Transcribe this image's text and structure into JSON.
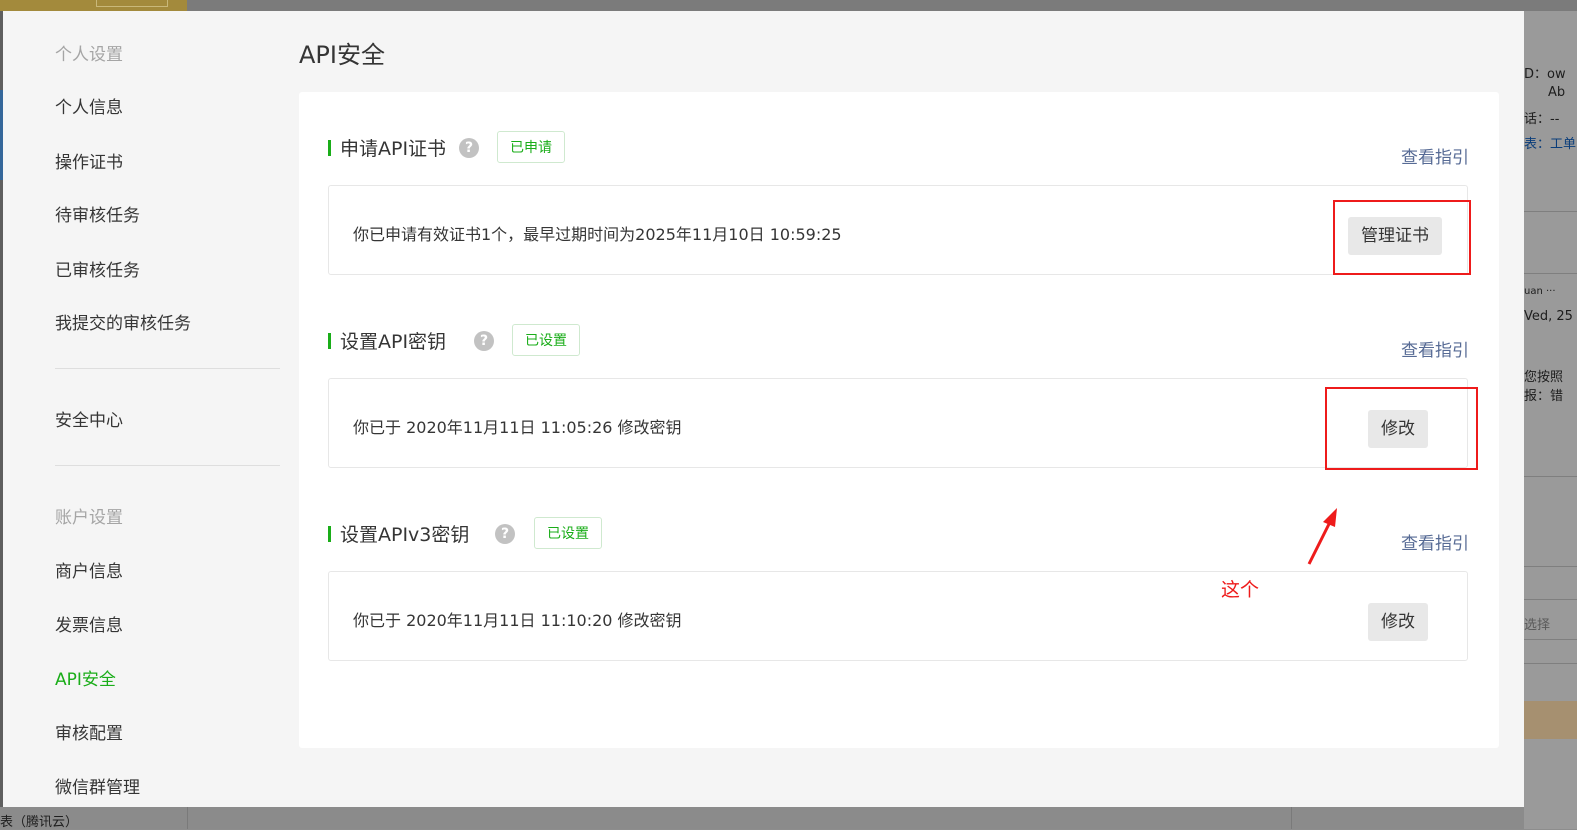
{
  "background": {
    "right_panel_texts": [
      "D：ow",
      "Ab",
      "话：--",
      "表：工单",
      "uan ···",
      "Ved, 25",
      "您按照",
      "报：错",
      "选择"
    ],
    "bottom_text": "表（腾讯云）"
  },
  "sidebar": {
    "groups": [
      {
        "title": "个人设置",
        "items": [
          "个人信息",
          "操作证书",
          "待审核任务",
          "已审核任务",
          "我提交的审核任务"
        ]
      },
      {
        "title": "",
        "items": [
          "安全中心"
        ]
      },
      {
        "title": "账户设置",
        "items": [
          "商户信息",
          "发票信息",
          "API安全",
          "审核配置",
          "微信群管理"
        ]
      }
    ],
    "active_item": "API安全"
  },
  "page": {
    "title": "API安全"
  },
  "sections": [
    {
      "title": "申请API证书",
      "badge": "已申请",
      "guide_link": "查看指引",
      "info": "你已申请有效证书1个，最早过期时间为2025年11月10日 10:59:25",
      "button": "管理证书"
    },
    {
      "title": "设置API密钥",
      "badge": "已设置",
      "guide_link": "查看指引",
      "info": "你已于 2020年11月11日 11:05:26 修改密钥",
      "button": "修改"
    },
    {
      "title": "设置APIv3密钥",
      "badge": "已设置",
      "guide_link": "查看指引",
      "info": "你已于 2020年11月11日 11:10:20 修改密钥",
      "button": "修改"
    }
  ],
  "annotation": {
    "text": "这个",
    "color": "#ee1b1b"
  },
  "colors": {
    "accent_green": "#1aad19",
    "link_blue": "#576b95",
    "annotation_red": "#ee1b1b"
  }
}
